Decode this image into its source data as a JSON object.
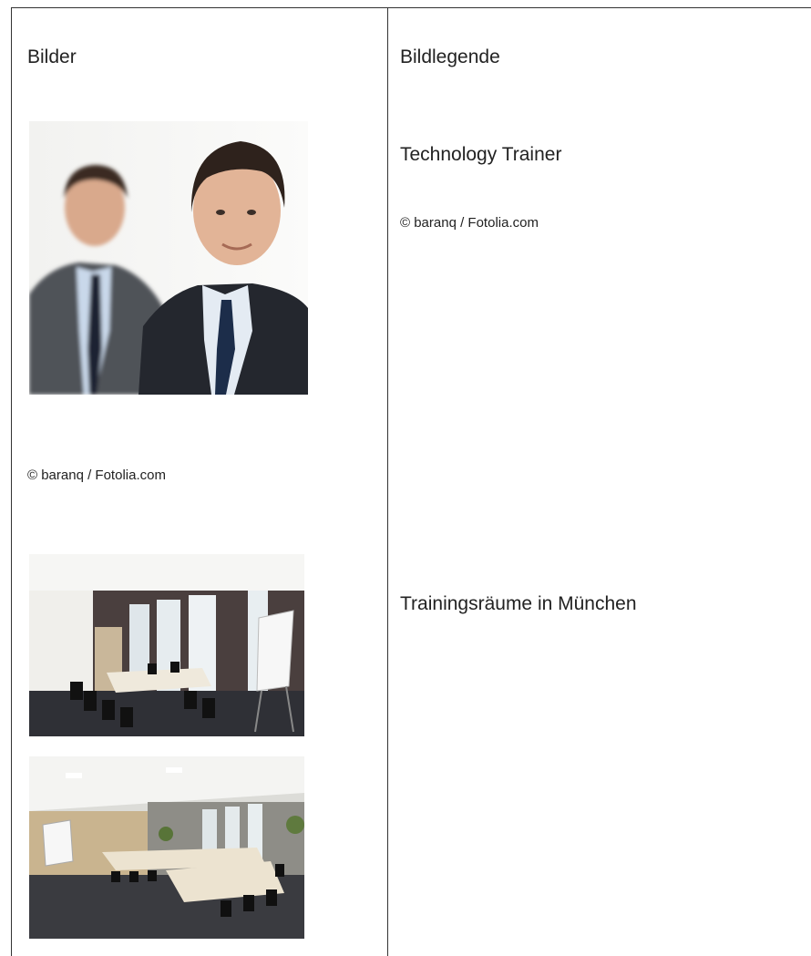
{
  "columns": {
    "left_header": "Bilder",
    "right_header": "Bildlegende"
  },
  "entries": [
    {
      "image_caption": "© baranq / Fotolia.com",
      "legend_title": "Technology Trainer",
      "legend_credit": "© baranq / Fotolia.com"
    },
    {
      "legend_title": "Trainingsräume in München"
    }
  ]
}
